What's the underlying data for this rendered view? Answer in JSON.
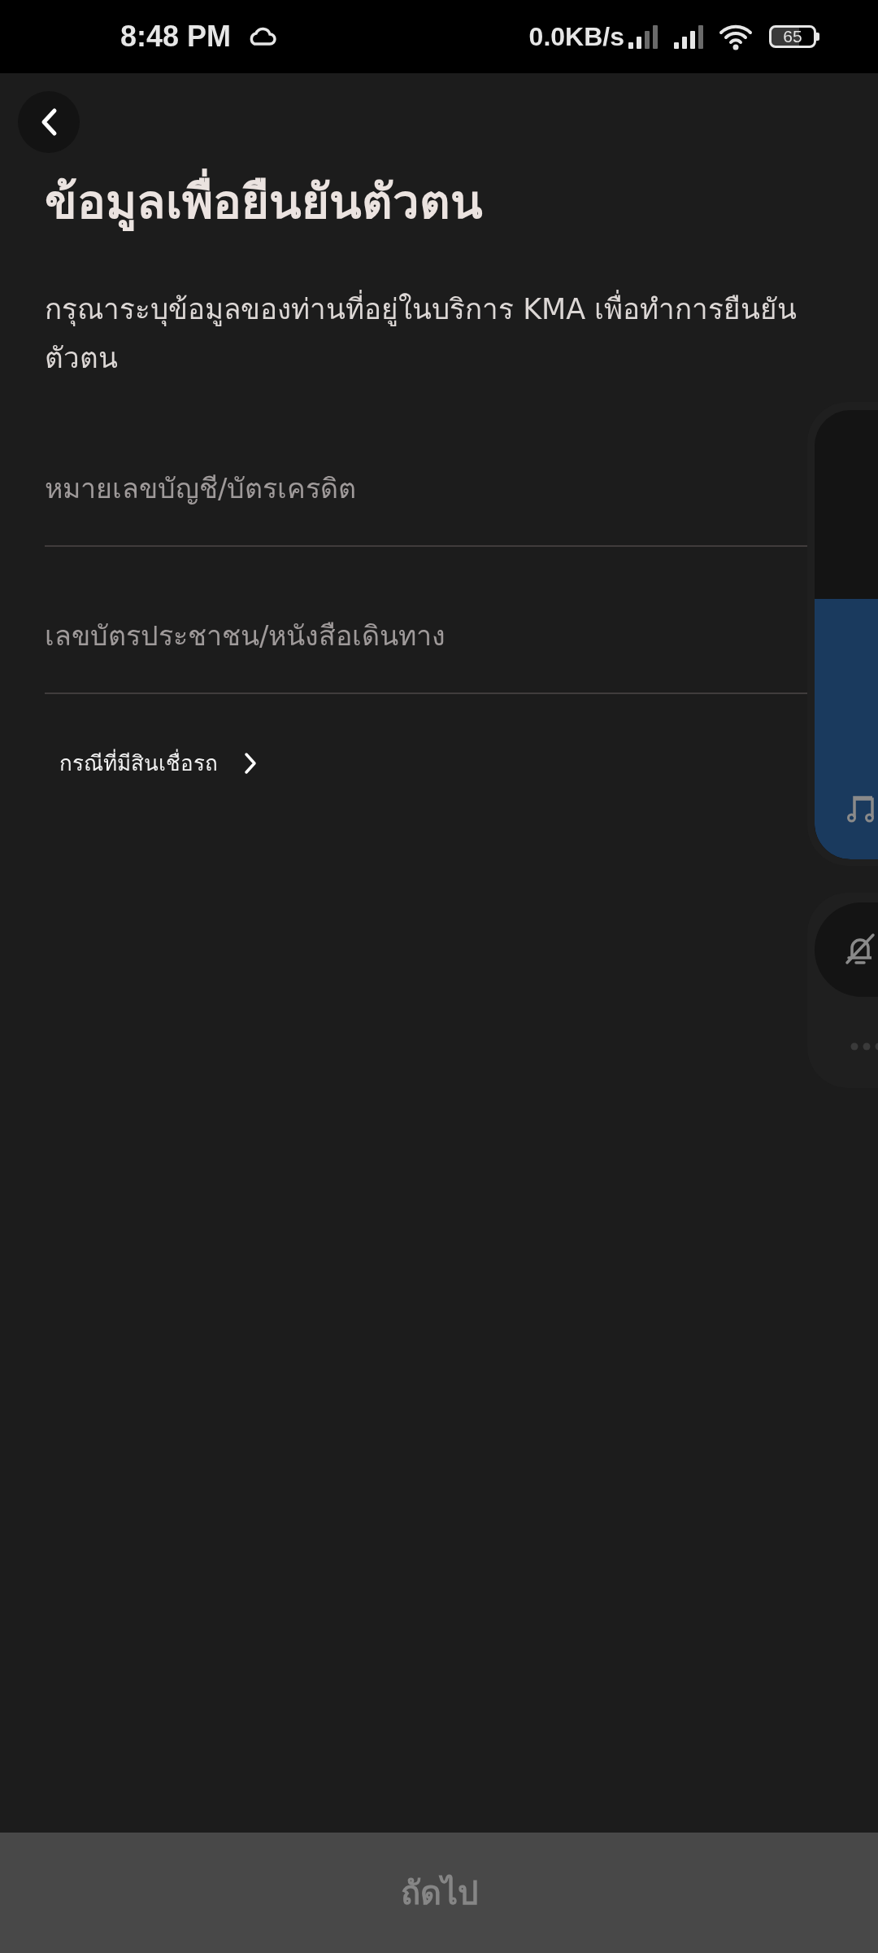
{
  "status_bar": {
    "time": "8:48 PM",
    "network_speed": "0.0KB/s",
    "battery": "65"
  },
  "title": "ข้อมูลเพื่อยืนยันตัวตน",
  "description": "กรุณาระบุข้อมูลของท่านที่อยู่ในบริการ KMA เพื่อทำการยืนยันตัวตน",
  "fields": [
    {
      "placeholder": "หมายเลขบัญชี/บัตรเครดิต"
    },
    {
      "placeholder": "เลขบัตรประชาชน/หนังสือเดินทาง"
    }
  ],
  "link": {
    "label": "กรณีที่มีสินเชื่อรถ"
  },
  "volume_panel": {
    "level": 0.58
  },
  "next_button": {
    "label": "ถัดไป",
    "disabled": true
  }
}
